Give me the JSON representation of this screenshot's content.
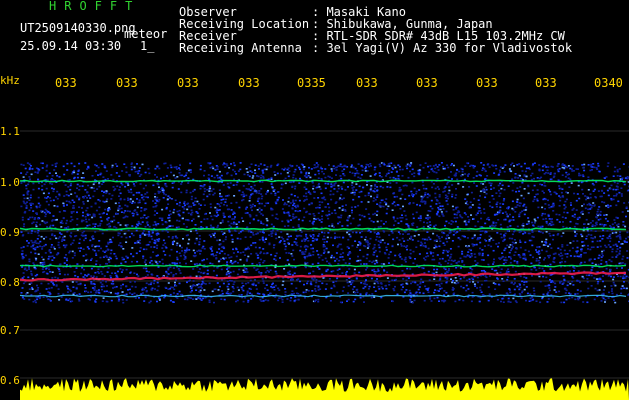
{
  "header": {
    "brand": "HROFFT",
    "filename": "UT2509140330.png",
    "mode": "meteor",
    "timestamp": "25.09.14 03:30",
    "page_indicator": "1_"
  },
  "meta": [
    {
      "key": "Observer",
      "value": ": Masaki Kano"
    },
    {
      "key": "Receiving Location",
      "value": ": Shibukawa, Gunma, Japan"
    },
    {
      "key": "Receiver",
      "value": ": RTL-SDR SDR# 43dB L15 103.2MHz CW"
    },
    {
      "key": "Receiving Antenna",
      "value": ": 3el Yagi(V) Az 330 for Vladivostok"
    }
  ],
  "axes": {
    "y_unit": "kHz",
    "y_ticks": [
      "1.1",
      "1.0",
      "0.9",
      "0.8",
      "0.7",
      "0.6"
    ],
    "time_ticks": [
      "033",
      "033",
      "033",
      "033",
      "0335",
      "033",
      "033",
      "033",
      "033",
      "0340"
    ]
  },
  "colors": {
    "background": "#000000",
    "label": "#ffd400",
    "brand": "#31d431",
    "noise": "#1a3cff",
    "signal": "#00ff66",
    "strong": "#ff2050",
    "amplitude": "#ffff00"
  }
}
